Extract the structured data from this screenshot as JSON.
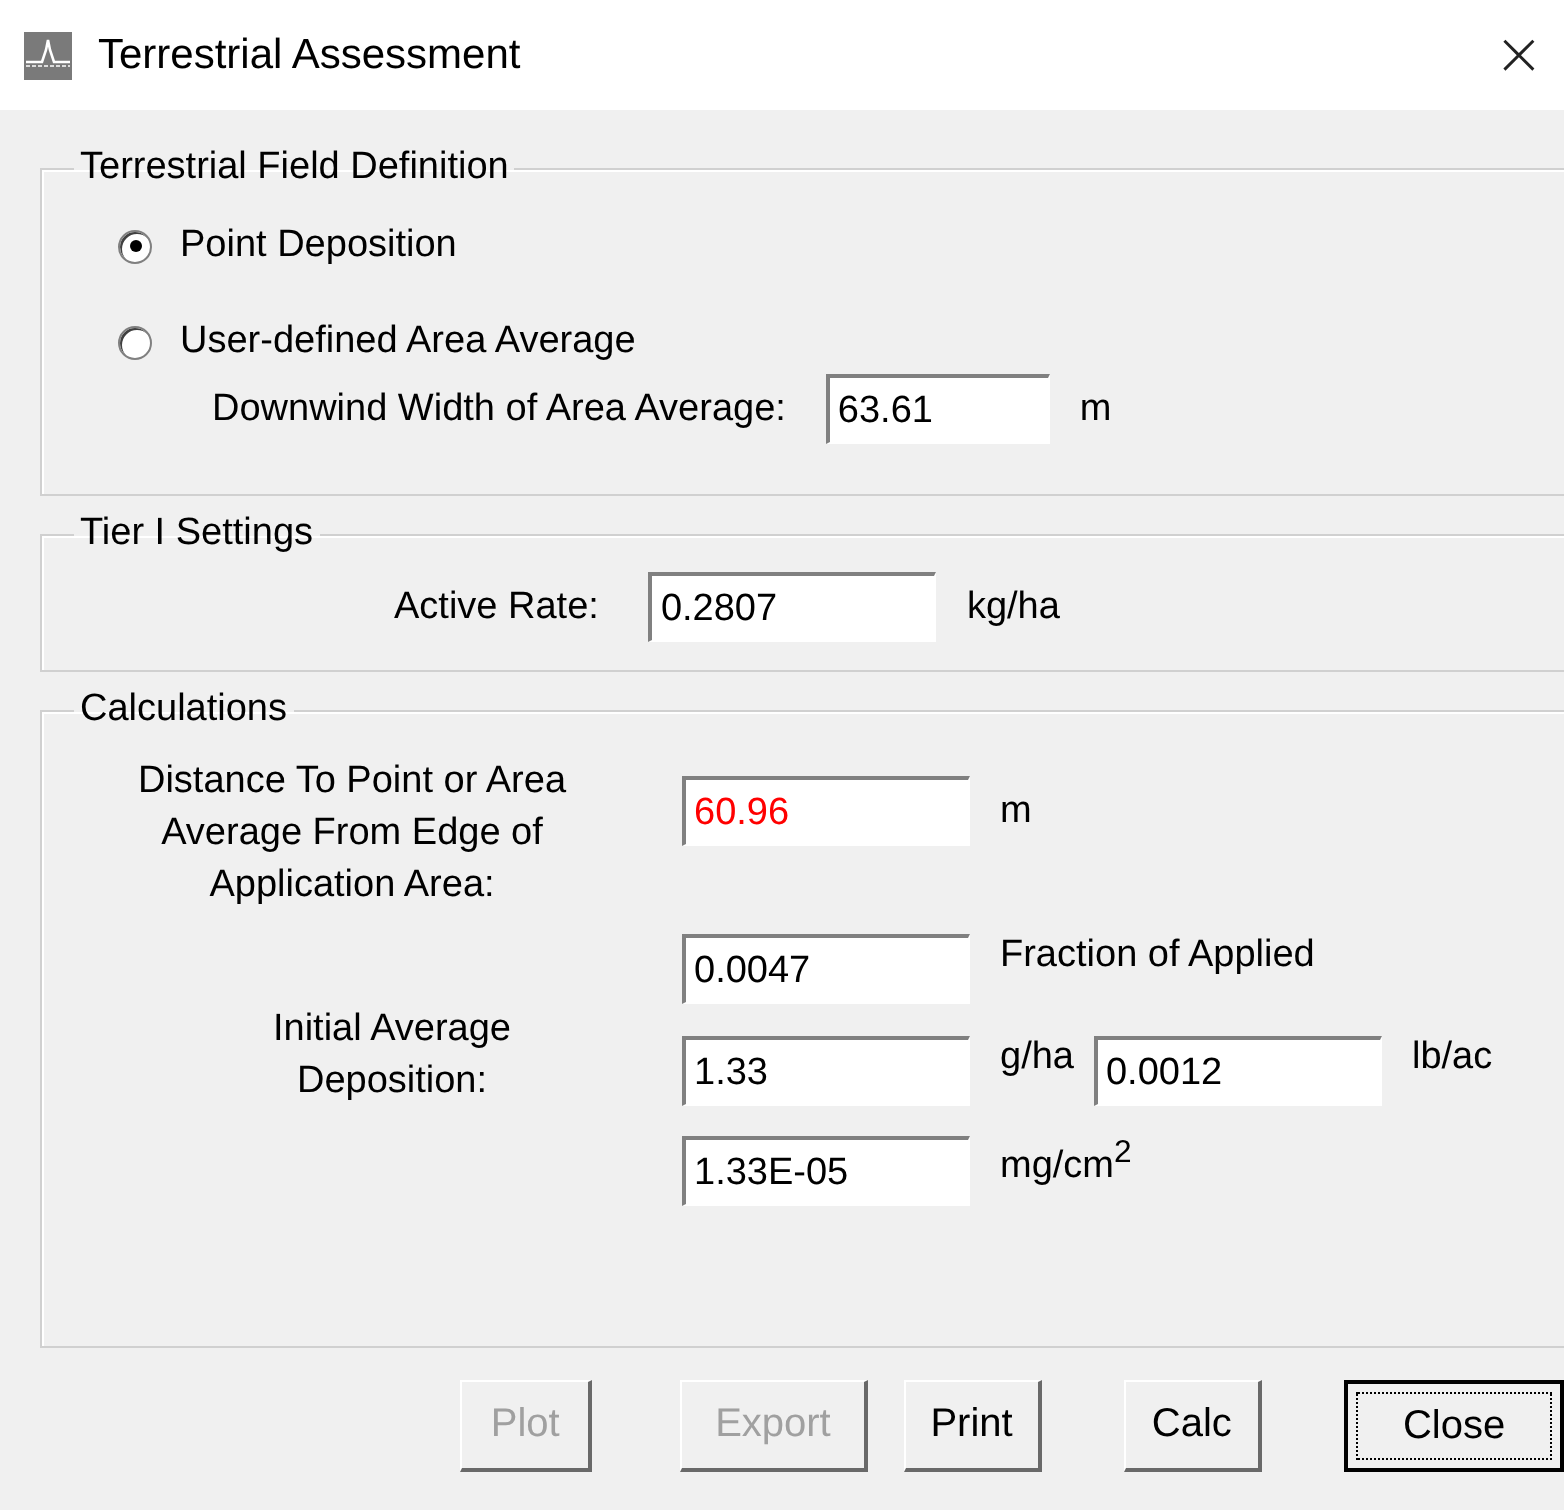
{
  "window": {
    "title": "Terrestrial Assessment",
    "close": "×"
  },
  "field_definition": {
    "title": "Terrestrial Field Definition",
    "options": [
      {
        "label": "Point Deposition",
        "selected": true
      },
      {
        "label": "User-defined Area Average",
        "selected": false
      }
    ],
    "width_label": "Downwind Width of Area Average:",
    "width_value": "63.61",
    "width_unit": "m"
  },
  "tier1": {
    "title": "Tier I Settings",
    "rate_label": "Active Rate:",
    "rate_value": "0.2807",
    "rate_unit": "kg/ha"
  },
  "calculations": {
    "title": "Calculations",
    "distance_label": "Distance To Point or Area Average From Edge of Application Area:",
    "distance_value": "60.96",
    "distance_alert": true,
    "distance_unit": "m",
    "deposition_label": "Initial Average Deposition:",
    "fraction_value": "0.0047",
    "fraction_unit": "Fraction of Applied",
    "gha_value": "1.33",
    "gha_unit": "g/ha",
    "lbac_value": "0.0012",
    "lbac_unit": "lb/ac",
    "mgcm_value": "1.33E-05",
    "mgcm_unit": "mg/cm$^{2}$"
  },
  "buttons": [
    {
      "label": "Plot",
      "disabled": true,
      "focused": false
    },
    {
      "label": "Export",
      "disabled": true,
      "focused": false
    },
    {
      "label": "Print",
      "disabled": false,
      "focused": false
    },
    {
      "label": "Calc",
      "disabled": false,
      "focused": false
    },
    {
      "label": "Close",
      "disabled": false,
      "focused": true
    }
  ]
}
